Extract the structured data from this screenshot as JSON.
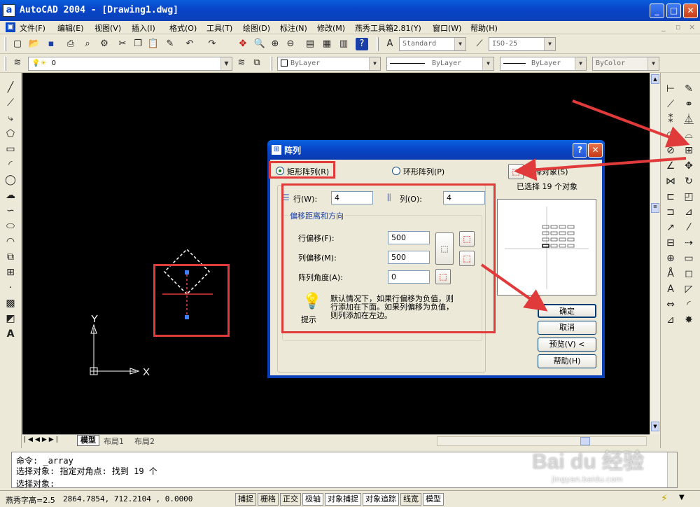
{
  "window": {
    "title": "AutoCAD 2004 - [Drawing1.dwg]",
    "app_icon": "a",
    "min_label": "_",
    "max_label": "□",
    "close_label": "✕"
  },
  "menu": [
    "文件(F)",
    "编辑(E)",
    "视图(V)",
    "插入(I)",
    "格式(O)",
    "工具(T)",
    "绘图(D)",
    "标注(N)",
    "修改(M)",
    "燕秀工具箱2.81(Y)",
    "窗口(W)",
    "帮助(H)"
  ],
  "menu_controls": [
    "_",
    "▫",
    "×"
  ],
  "toolbar1": {
    "text_style": "Standard",
    "dim_style": "ISO-25"
  },
  "toolbar2": {
    "layer_name": "0",
    "color": "ByLayer",
    "linetype": "ByLayer",
    "lineweight": "ByLayer",
    "plotstyle": "ByColor"
  },
  "ucs": {
    "y_label": "Y",
    "x_label": "X"
  },
  "layout_tabs": [
    "模型",
    "布局1",
    "布局2"
  ],
  "command_lines": [
    "命令: _array",
    "选择对象: 指定对角点: 找到 19 个",
    "选择对象:"
  ],
  "status": {
    "text_height": "燕秀字高=2.5",
    "coords": "2864.7854, 712.2104 , 0.0000",
    "toggles": [
      "捕捉",
      "栅格",
      "正交",
      "极轴",
      "对象捕捉",
      "对象追踪",
      "线宽",
      "模型"
    ]
  },
  "dialog": {
    "title": "阵列",
    "help_btn": "?",
    "close_btn": "✕",
    "rect_array": "矩形阵列(R)",
    "polar_array": "环形阵列(P)",
    "select_objects": "选择对象(S)",
    "selected_count": "已选择 19 个对象",
    "rows_label": "行(W):",
    "rows_value": "4",
    "cols_label": "列(O):",
    "cols_value": "4",
    "offset_group": "偏移距离和方向",
    "row_offset_label": "行偏移(F):",
    "row_offset_value": "500",
    "col_offset_label": "列偏移(M):",
    "col_offset_value": "500",
    "angle_label": "阵列角度(A):",
    "angle_value": "0",
    "tip_label": "提示",
    "tip_text_1": "默认情况下，如果行偏移为负值，则",
    "tip_text_2": "行添加在下面。如果列偏移为负值，",
    "tip_text_3": "则列添加在左边。",
    "ok": "确定",
    "cancel": "取消",
    "preview": "预览(V) <",
    "help": "帮助(H)"
  },
  "watermark": {
    "brand": "Bai du 经验",
    "url": "jingyan.baidu.com"
  },
  "colors": {
    "title_blue": "#0846c8",
    "highlight_red": "#e03a3a",
    "canvas": "#000000"
  }
}
